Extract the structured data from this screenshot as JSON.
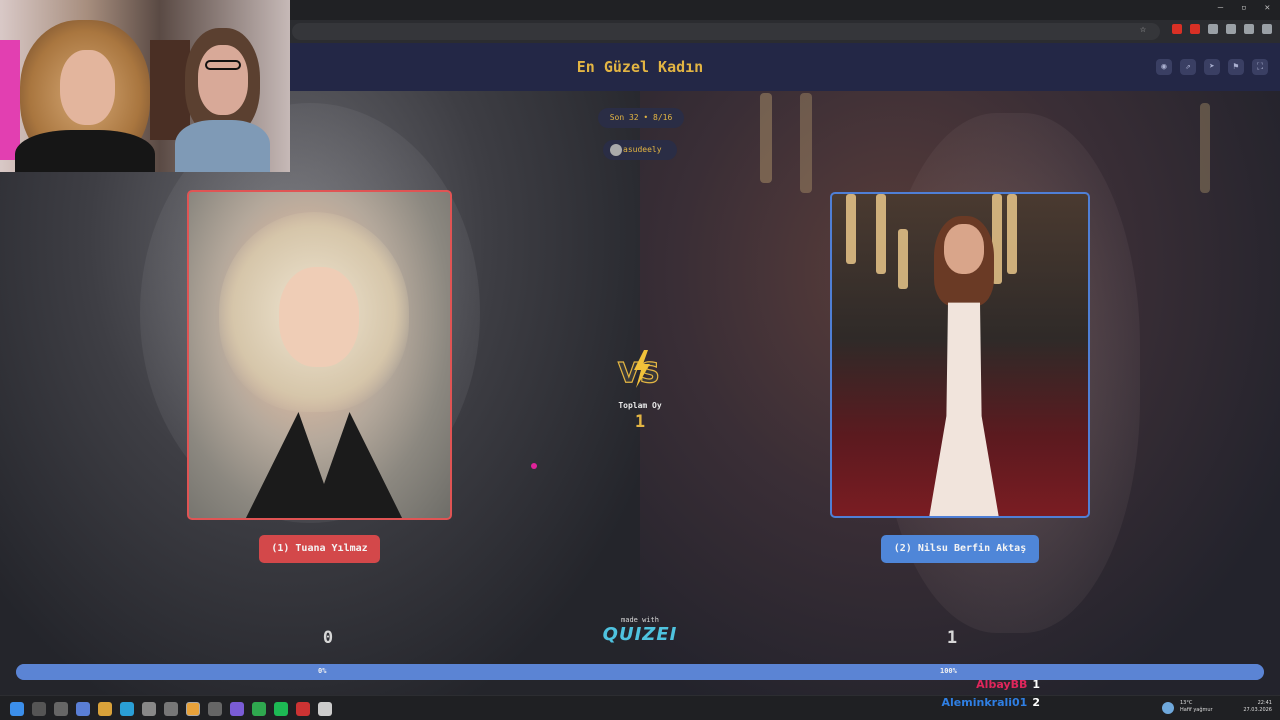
{
  "header": {
    "title": "En Güzel Kadın",
    "icons": [
      "eye-icon",
      "share-icon",
      "send-icon",
      "flag-icon",
      "fullscreen-icon"
    ]
  },
  "round": "Son 32 • 8/16",
  "user": "asudeely",
  "left": {
    "name": "(1) Tuana Yılmaz",
    "score": "0",
    "percent": "0%",
    "fraction": 0,
    "accent": "#d3484a"
  },
  "right": {
    "name": "(2) Nilsu Berfin Aktaş",
    "score": "1",
    "percent": "100%",
    "fraction": 1,
    "accent": "#4f86d8"
  },
  "total": {
    "label": "Toplam Oy",
    "value": "1"
  },
  "branding": {
    "made_with": "made with",
    "brand": "QUIZEI"
  },
  "chat": [
    {
      "user": "AlbayBB",
      "value": "1"
    },
    {
      "user": "Aleminkrali01",
      "value": "2"
    }
  ],
  "taskbar": {
    "weather_temp": "13°C",
    "weather_desc": "Hafif yağmur",
    "time": "22:41",
    "date": "27.03.2026"
  },
  "colors": {
    "title_gold": "#e3b543",
    "header_bg": "#232746",
    "brand_cyan": "#4fc3df"
  }
}
